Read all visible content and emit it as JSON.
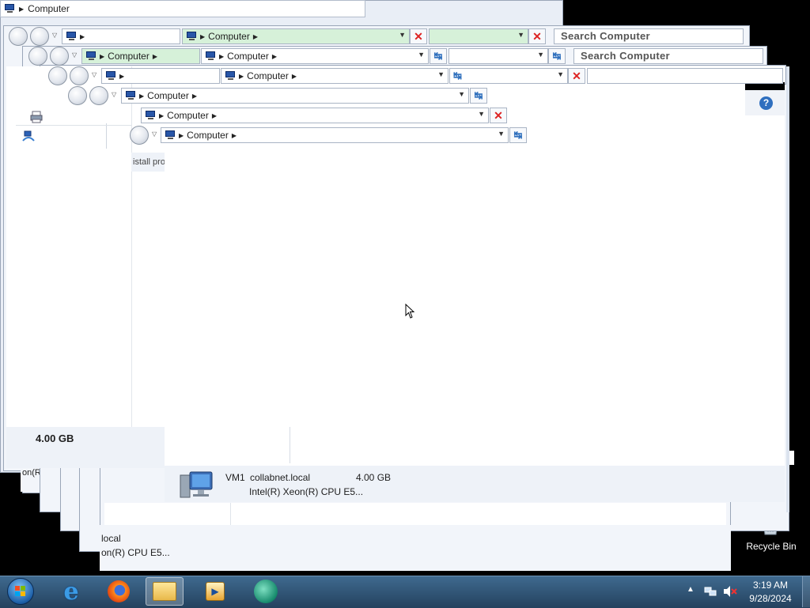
{
  "windows": {
    "w0": {
      "address": "Computer"
    },
    "w1": {
      "address": "Computer",
      "search_placeholder": "Search Computer"
    },
    "w2": {
      "address": "Computer",
      "search_placeholder": "Search Computer"
    },
    "w3": {
      "address": ""
    },
    "w4": {
      "address": "Computer"
    },
    "w5": {
      "address": "Computer"
    },
    "w6": {
      "address": "Computer"
    }
  },
  "fragment_text": "istall pro",
  "details": {
    "memory_value": "4.00 GB",
    "computer_name": "VM1",
    "domain": "collabnet.local",
    "memory": "4.00 GB",
    "processor": "Intel(R) Xeon(R) CPU E5...",
    "ghost_domain": "local",
    "ghost_processor": "on(R) CPU E5...",
    "ghost_processor_left": "on(R"
  },
  "desktop": {
    "recycle_bin_label": "Recycle Bin"
  },
  "taskbar": {
    "start_icon": "windows-orb-icon",
    "pinned": [
      "internet-explorer-icon",
      "firefox-icon",
      "windows-explorer-icon",
      "media-player-icon",
      "app-icon"
    ],
    "tray": {
      "time": "3:19 AM",
      "date": "9/28/2024"
    }
  }
}
